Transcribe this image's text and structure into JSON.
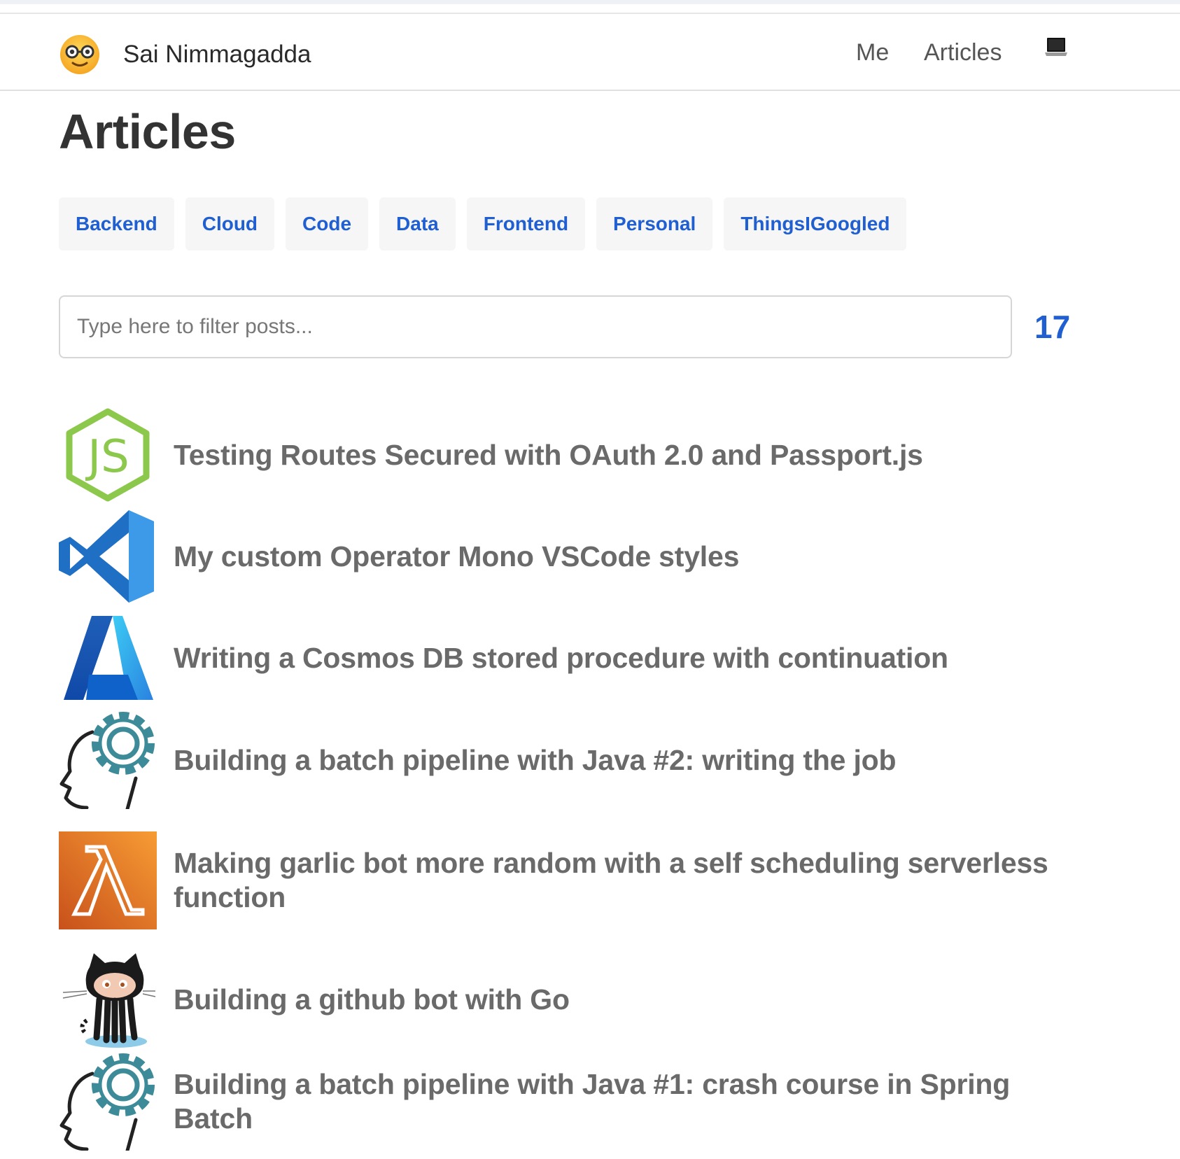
{
  "header": {
    "site_name": "Sai Nimmagadda",
    "nav": [
      {
        "label": "Me"
      },
      {
        "label": "Articles"
      }
    ],
    "icons": [
      "nerd-face-emoji-icon",
      "laptop-icon"
    ]
  },
  "main": {
    "title": "Articles",
    "tags": [
      "Backend",
      "Cloud",
      "Code",
      "Data",
      "Frontend",
      "Personal",
      "ThingsIGoogled"
    ],
    "filter": {
      "placeholder": "Type here to filter posts...",
      "value": ""
    },
    "post_count": "17",
    "posts": [
      {
        "title": "Testing Routes Secured with OAuth 2.0 and Passport.js",
        "icon": "nodejs-icon"
      },
      {
        "title": "My custom Operator Mono VSCode styles",
        "icon": "vscode-icon"
      },
      {
        "title": "Writing a Cosmos DB stored procedure with continuation",
        "icon": "azure-icon"
      },
      {
        "title": "Building a batch pipeline with Java #2: writing the job",
        "icon": "head-gear-icon"
      },
      {
        "title": "Making garlic bot more random with a self scheduling serverless function",
        "icon": "aws-lambda-icon"
      },
      {
        "title": "Building a github bot with Go",
        "icon": "octocat-icon"
      },
      {
        "title": "Building a batch pipeline with Java #1: crash course in Spring Batch",
        "icon": "head-gear-icon"
      }
    ]
  },
  "colors": {
    "link_blue": "#1f5fd1",
    "tag_bg": "#f6f6f6",
    "post_title": "#6a6a6a",
    "nodejs_green": "#8cc84b",
    "vscode_blue": "#2b7fd8",
    "azure_blue": "#1d6fd0",
    "gear_teal": "#3d8a98",
    "lambda_orange": "#e8822c"
  }
}
